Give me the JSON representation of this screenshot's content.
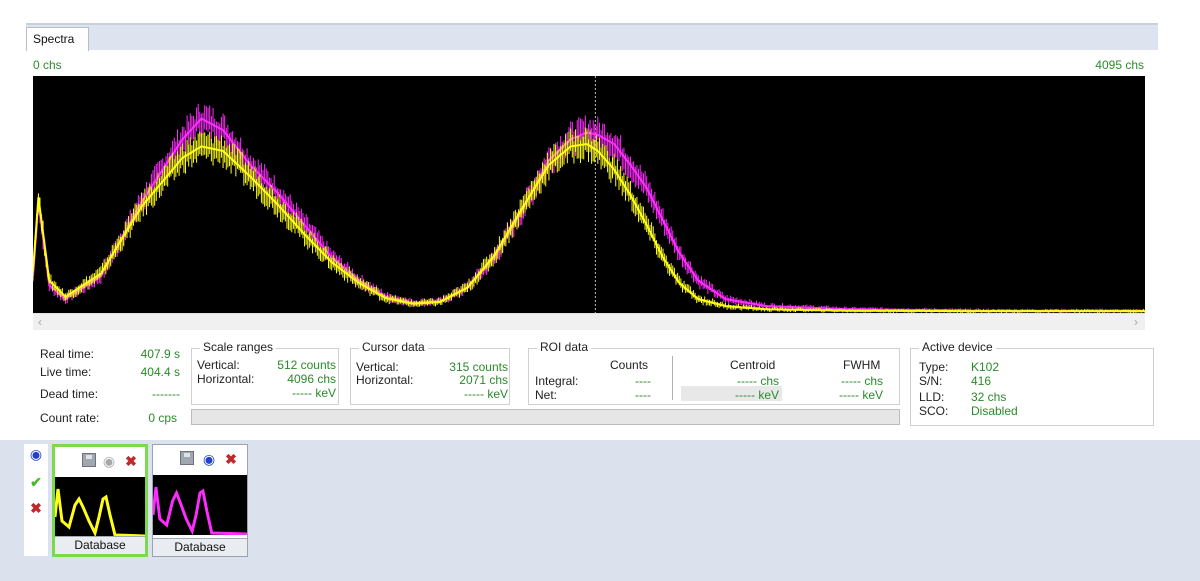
{
  "tab": {
    "label": "Spectra"
  },
  "axis": {
    "left_label": "0 chs",
    "right_label": "4095 chs"
  },
  "stats": {
    "real_time_label": "Real time:",
    "real_time_value": "407.9 s",
    "live_time_label": "Live time:",
    "live_time_value": "404.4 s",
    "dead_time_label": "Dead time:",
    "dead_time_value": "-------",
    "count_rate_label": "Count rate:",
    "count_rate_value": "0 cps"
  },
  "scale_ranges": {
    "title": "Scale ranges",
    "vertical_label": "Vertical:",
    "vertical_value": "512 counts",
    "horizontal_label": "Horizontal:",
    "horizontal_value": "4096 chs",
    "kev_value": "----- keV"
  },
  "cursor_data": {
    "title": "Cursor data",
    "vertical_label": "Vertical:",
    "vertical_value": "315 counts",
    "horizontal_label": "Horizontal:",
    "horizontal_value": "2071 chs",
    "kev_value": "----- keV"
  },
  "roi_data": {
    "title": "ROI data",
    "col_counts": "Counts",
    "col_centroid": "Centroid",
    "col_fwhm": "FWHM",
    "integral_label": "Integral:",
    "integral_counts": "----",
    "net_label": "Net:",
    "net_counts": "----",
    "centroid_chs": "----- chs",
    "centroid_kev": "----- keV",
    "fwhm_chs": "----- chs",
    "fwhm_kev": "----- keV"
  },
  "active_device": {
    "title": "Active device",
    "type_label": "Type:",
    "type_value": "K102",
    "sn_label": "S/N:",
    "sn_value": "416",
    "lld_label": "LLD:",
    "lld_value": "32 chs",
    "sco_label": "SCO:",
    "sco_value": "Disabled"
  },
  "progress": {
    "fraction": 0
  },
  "colors": {
    "series_magenta": "#ff2cff",
    "series_yellow": "#ffff1a",
    "cursor": "#bfbfbf",
    "value_green": "#2a8a2a"
  },
  "side_tools": [
    "eye-icon",
    "check-icon",
    "delete-icon"
  ],
  "thumbnails": [
    {
      "caption": "Database",
      "color": "#ffff1a",
      "selected": true,
      "icons": [
        "save-icon",
        "eye-icon",
        "delete-icon"
      ]
    },
    {
      "caption": "Database",
      "color": "#ff2cff",
      "selected": false,
      "icons": [
        "save-icon",
        "eye-icon",
        "delete-icon"
      ]
    }
  ],
  "chart_data": {
    "type": "line",
    "xlim": [
      0,
      4095
    ],
    "ylim": [
      0,
      512
    ],
    "cursor_x": 2071,
    "series": [
      {
        "color": "#ff2cff",
        "x": [
          0,
          20,
          60,
          120,
          250,
          400,
          550,
          620,
          700,
          800,
          900,
          1000,
          1100,
          1200,
          1300,
          1400,
          1500,
          1600,
          1700,
          1800,
          1900,
          1980,
          2040,
          2080,
          2140,
          2200,
          2260,
          2320,
          2380,
          2450,
          2550,
          2700,
          3000,
          3500,
          4095
        ],
        "values": [
          80,
          240,
          60,
          30,
          80,
          240,
          375,
          420,
          395,
          320,
          260,
          190,
          120,
          70,
          35,
          22,
          25,
          55,
          120,
          220,
          330,
          375,
          390,
          385,
          365,
          320,
          270,
          200,
          130,
          70,
          30,
          15,
          8,
          5,
          5
        ]
      },
      {
        "color": "#ffff1a",
        "x": [
          0,
          20,
          60,
          120,
          250,
          400,
          550,
          620,
          700,
          800,
          900,
          1000,
          1100,
          1200,
          1300,
          1400,
          1500,
          1600,
          1700,
          1800,
          1900,
          1980,
          2040,
          2080,
          2140,
          2200,
          2260,
          2320,
          2380,
          2450,
          2550,
          2700,
          3000,
          3500,
          4095
        ],
        "values": [
          90,
          250,
          70,
          35,
          85,
          230,
          335,
          360,
          350,
          295,
          235,
          170,
          110,
          65,
          32,
          20,
          24,
          55,
          125,
          225,
          320,
          360,
          365,
          350,
          310,
          255,
          190,
          120,
          65,
          30,
          15,
          8,
          5,
          4,
          4
        ]
      }
    ]
  }
}
